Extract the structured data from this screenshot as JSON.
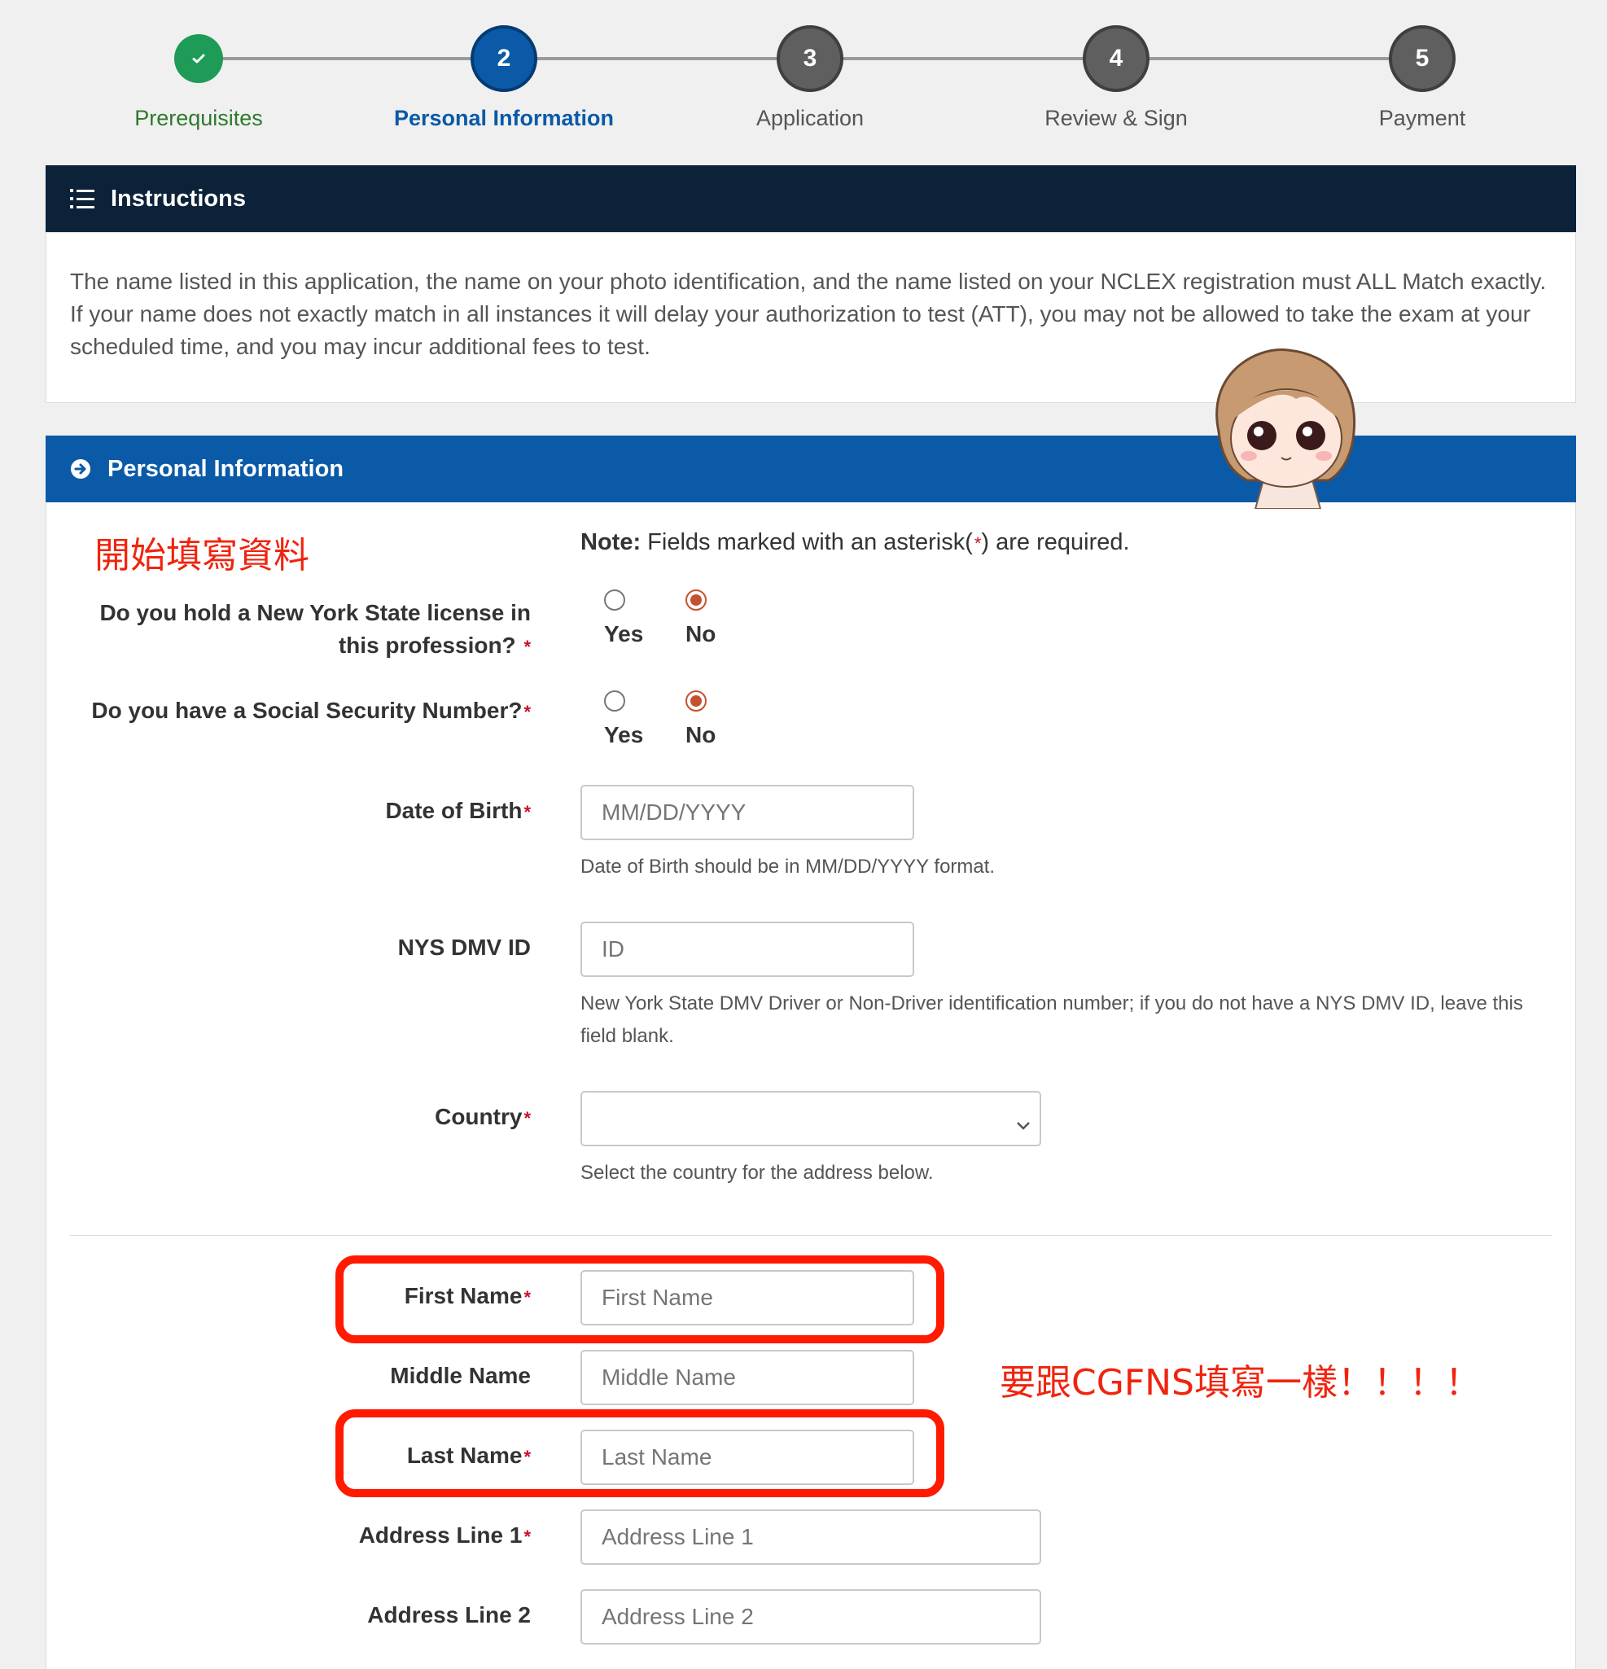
{
  "stepper": {
    "steps": [
      {
        "number": "",
        "label": "Prerequisites",
        "state": "done"
      },
      {
        "number": "2",
        "label": "Personal Information",
        "state": "active"
      },
      {
        "number": "3",
        "label": "Application",
        "state": "todo"
      },
      {
        "number": "4",
        "label": "Review & Sign",
        "state": "todo"
      },
      {
        "number": "5",
        "label": "Payment",
        "state": "todo"
      }
    ]
  },
  "instructions": {
    "title": "Instructions",
    "text": "The name listed in this application, the name on your photo identification, and the name listed on your NCLEX registration must ALL Match exactly. If your name does not exactly match in all instances it will delay your authorization to test (ATT), you may not be allowed to take the exam at your scheduled time, and you may incur additional fees to test."
  },
  "personal": {
    "title": "Personal Information",
    "note_bold": "Note:",
    "note_text": " Fields marked with an asterisk(",
    "note_star": "*",
    "note_end": ") are required.",
    "license_q_line1": "Do you hold a New York State license in",
    "license_q_line2": "this profession?",
    "ssn_q": "Do you have a Social Security Number?",
    "yes": "Yes",
    "no": "No",
    "dob_label": "Date of Birth",
    "dob_placeholder": "MM/DD/YYYY",
    "dob_help": "Date of Birth should be in MM/DD/YYYY format.",
    "dmv_label": "NYS DMV ID",
    "dmv_placeholder": "ID",
    "dmv_help": "New York State DMV Driver or Non-Driver identification number; if you do not have a NYS DMV ID, leave this field blank.",
    "country_label": "Country",
    "country_help": "Select the country for the address below.",
    "first_label": "First Name",
    "first_placeholder": "First Name",
    "middle_label": "Middle Name",
    "middle_placeholder": "Middle Name",
    "last_label": "Last Name",
    "last_placeholder": "Last Name",
    "addr1_label": "Address Line 1",
    "addr1_placeholder": "Address Line 1",
    "addr2_label": "Address Line 2",
    "addr2_placeholder": "Address Line 2",
    "star": "*"
  },
  "annotations": {
    "start": "開始填寫資料",
    "same_as": "要跟CGFNS填寫一樣！！！！"
  },
  "colors": {
    "navy": "#0b2239",
    "blue": "#0a5aa8",
    "green": "#1e9b57",
    "annotation_red": "#ff1a00"
  }
}
